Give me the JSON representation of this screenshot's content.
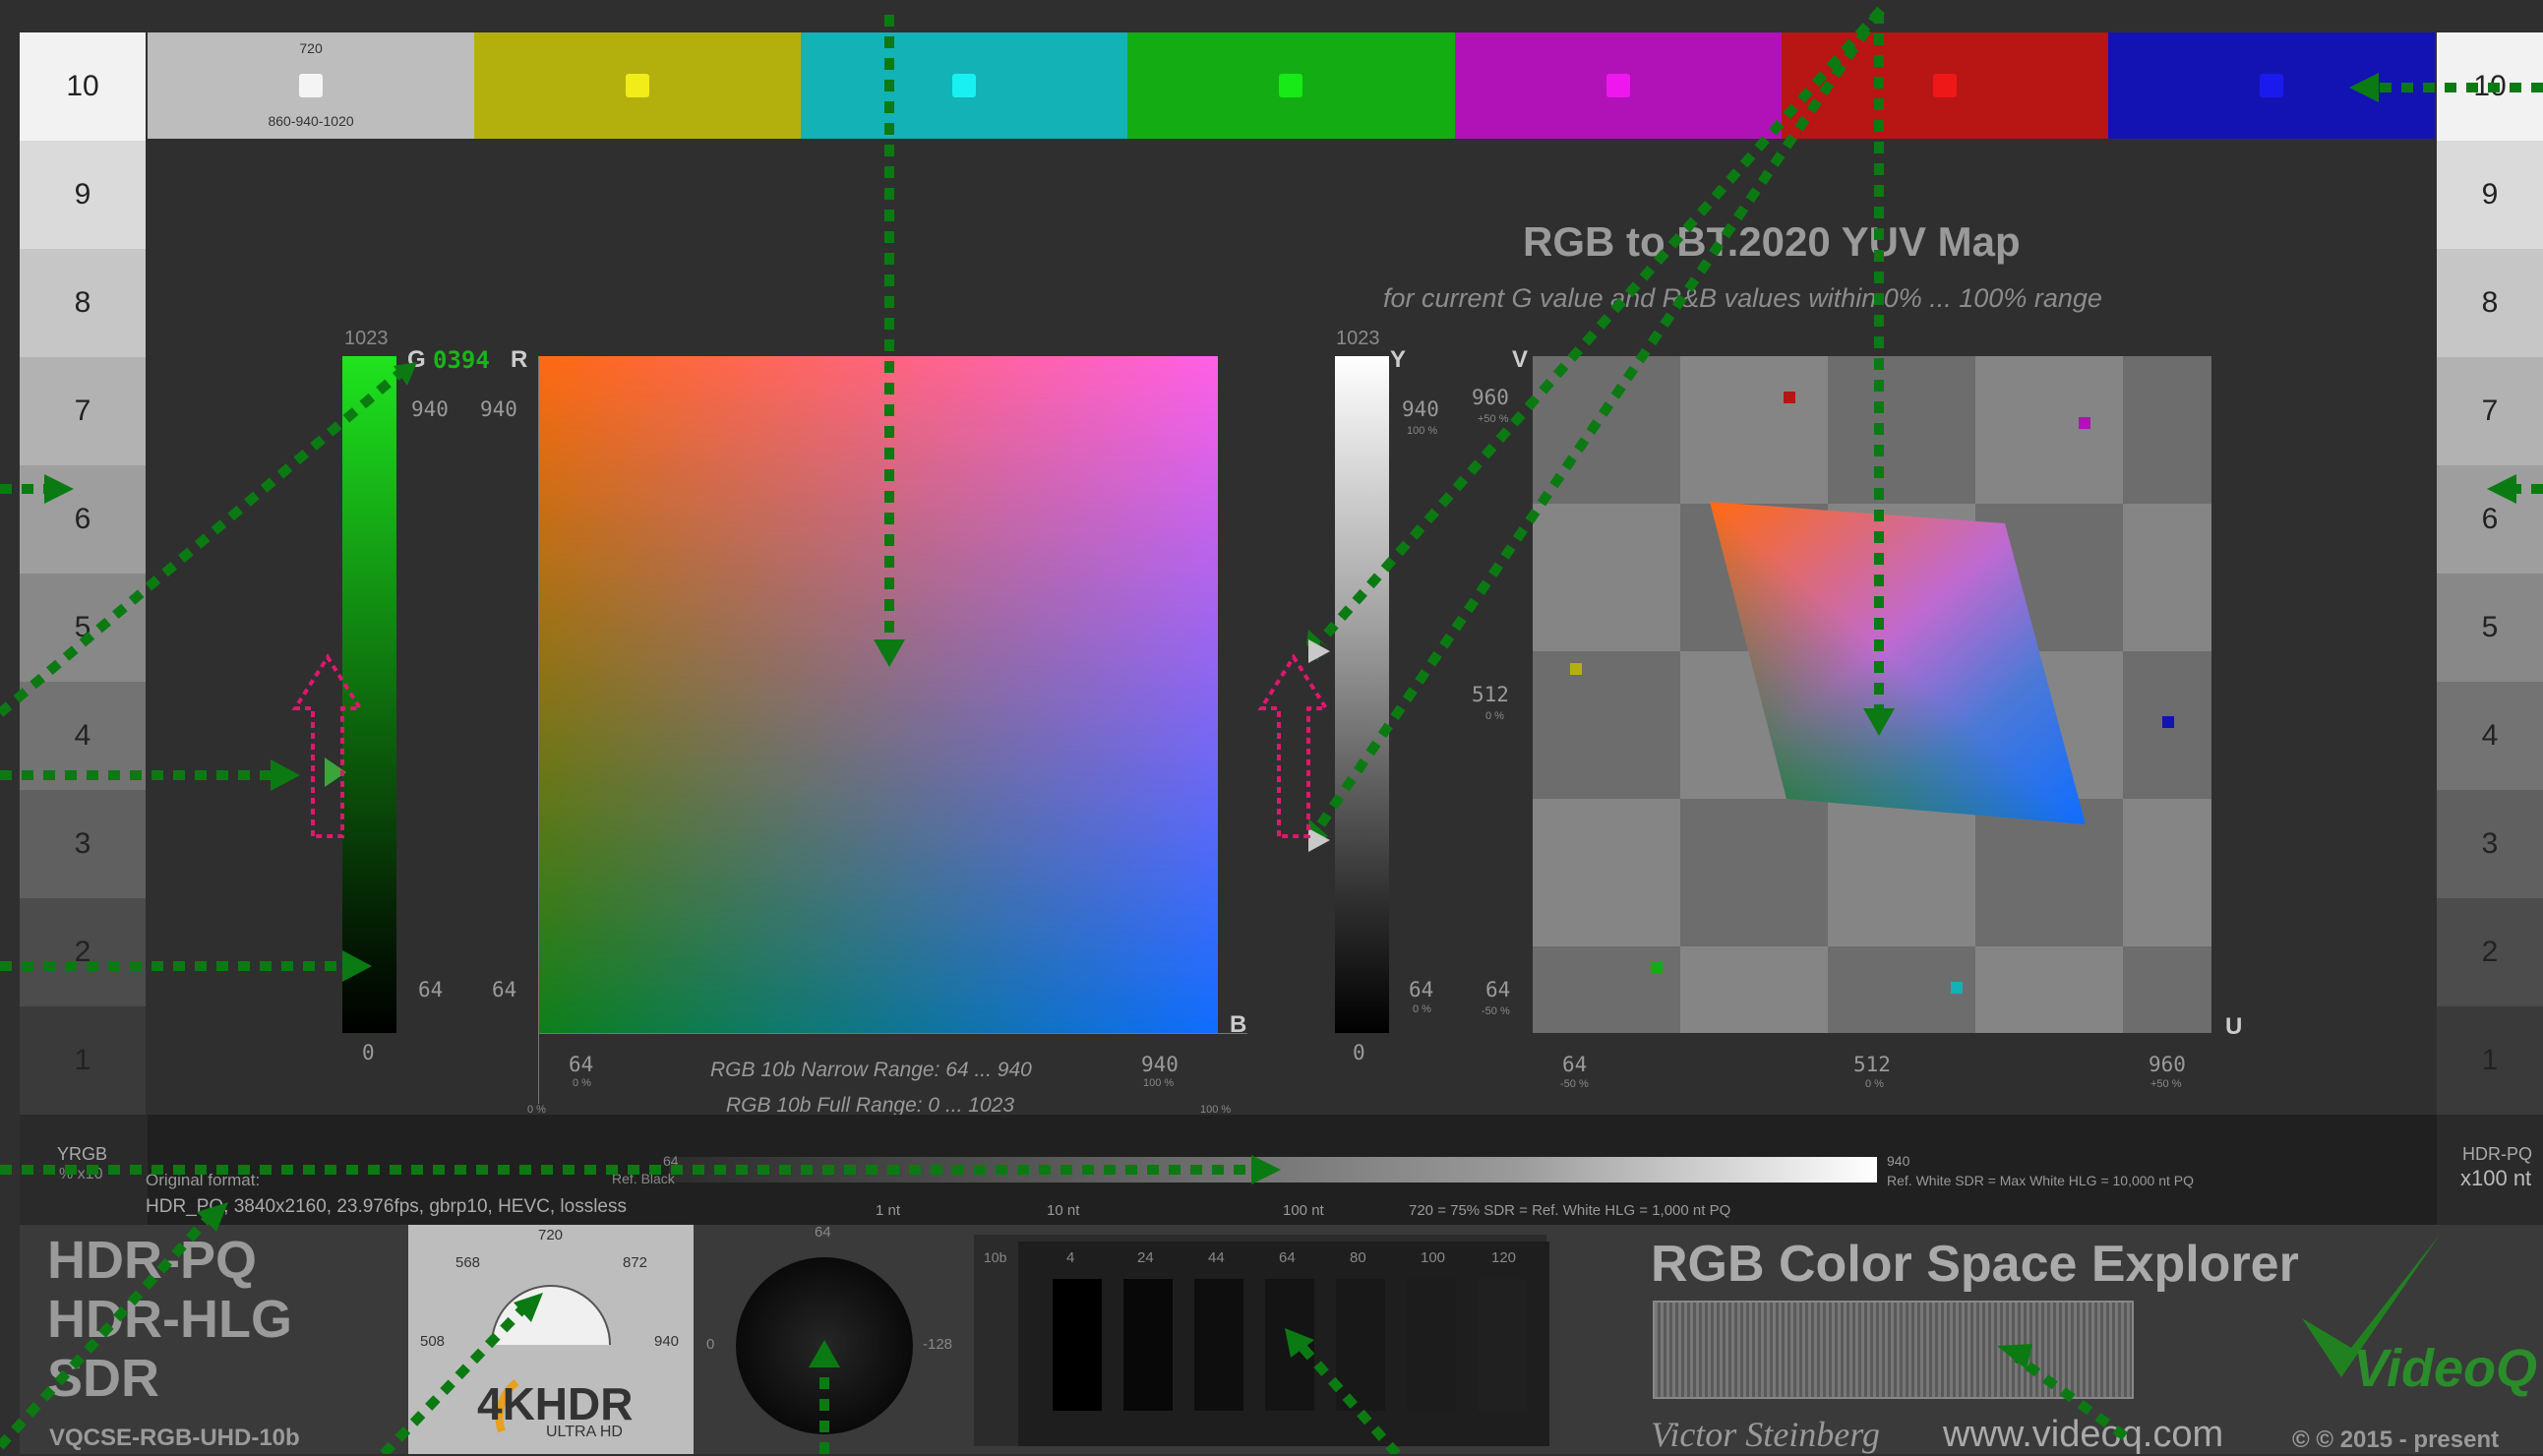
{
  "scales": {
    "left": [
      "10",
      "9",
      "8",
      "7",
      "6",
      "5",
      "4",
      "3",
      "2",
      "1"
    ],
    "right": [
      "10",
      "9",
      "8",
      "7",
      "6",
      "5",
      "4",
      "3",
      "2",
      "1"
    ],
    "left_footer_title": "YRGB",
    "left_footer_sub": "% x10",
    "right_footer_title": "HDR-PQ",
    "right_footer_sub": "x100 nt"
  },
  "top_bars": {
    "colors": [
      "#bdbdbd",
      "#b3b00e",
      "#12b2b6",
      "#13ad13",
      "#b012b7",
      "#b81515",
      "#1313b3"
    ],
    "square_colors": [
      "#f4f4f4",
      "#f0ed18",
      "#19f0f2",
      "#17ea17",
      "#ee18ee",
      "#ee1818",
      "#1a1aee"
    ],
    "white_label_top": "720",
    "white_label_bottom": "860-940-1020"
  },
  "yuv_map": {
    "title": "RGB to BT.2020 YUV Map",
    "subtitle": "for current G value and R&B values within 0% ... 100% range",
    "v_label": "V",
    "u_label": "U",
    "v_ticks": [
      {
        "v": "960",
        "p": "+50 %"
      },
      {
        "v": "512",
        "p": "0 %"
      },
      {
        "v": "64",
        "p": "-50 %"
      }
    ],
    "u_ticks": [
      {
        "v": "64",
        "p": "-50 %"
      },
      {
        "v": "512",
        "p": "0 %"
      },
      {
        "v": "960",
        "p": "+50 %"
      }
    ]
  },
  "g_slider": {
    "top": "1023",
    "g_label": "G",
    "g_value": "0394",
    "t940": "940",
    "t64": "64",
    "bottom": "0"
  },
  "rb_square": {
    "r_label": "R",
    "b_label": "B",
    "r940": "940",
    "r64": "64",
    "b64": "64",
    "b64_p": "0 %",
    "b940": "940",
    "b940_p": "100 %",
    "b0_p": "0 %",
    "b1023_p": "100 %",
    "narrow": "RGB 10b Narrow Range: 64 ... 940",
    "full": "RGB 10b Full Range: 0 ... 1023"
  },
  "y_slider": {
    "top": "1023",
    "y_label": "Y",
    "t940": "940",
    "t940_p": "100 %",
    "t64": "64",
    "t64_p": "0 %",
    "bottom": "0"
  },
  "pq_bar": {
    "original_format_label": "Original format:",
    "original_format": "HDR_PQ, 3840x2160, 23.976fps, gbrp10, HEVC, lossless",
    "ref_black_val": "64",
    "ref_black": "Ref. Black",
    "nt1": "1 nt",
    "nt10": "10 nt",
    "nt100": "100 nt",
    "note": "720 = 75% SDR = Ref. White HLG = 1,000 nt PQ",
    "white_val": "940",
    "white_note": "Ref. White SDR = Max White HLG = 10,000 nt PQ"
  },
  "modes": [
    "HDR-PQ",
    "HDR-HLG",
    "SDR"
  ],
  "file_name": "VQCSE-RGB-UHD-10b",
  "gauge": {
    "top": "720",
    "left": "568",
    "right": "872",
    "lmid": "508",
    "rmid": "940",
    "logo_main": "4KHDR",
    "logo_sub": "ULTRA HD"
  },
  "black_circle": {
    "top": "64",
    "left": "0",
    "right": "-128"
  },
  "near_black": {
    "unit": "10b",
    "values": [
      "4",
      "24",
      "44",
      "64",
      "80",
      "100",
      "120"
    ]
  },
  "branding": {
    "title": "RGB Color Space Explorer",
    "author": "Victor Steinberg",
    "url": "www.videoq.com",
    "logo": "VideoQ",
    "copyright": "© © 2015 - present"
  },
  "colors": {
    "arrow_green": "#0b7a12",
    "arrow_pink": "#e0176f"
  }
}
